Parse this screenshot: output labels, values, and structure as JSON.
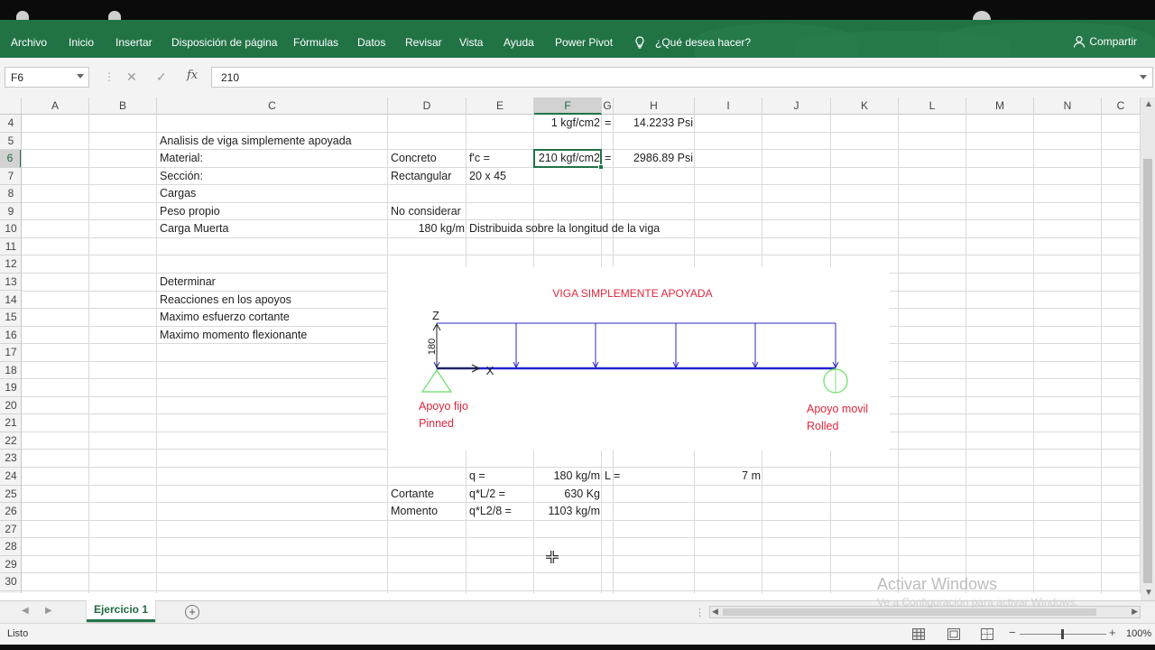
{
  "ribbon": {
    "tabs": [
      "Archivo",
      "Inicio",
      "Insertar",
      "Disposición de página",
      "Fórmulas",
      "Datos",
      "Revisar",
      "Vista",
      "Ayuda",
      "Power Pivot"
    ],
    "tell_me": "¿Qué desea hacer?",
    "share": "Compartir"
  },
  "formula_bar": {
    "name_box": "F6",
    "fx": "fx",
    "value": "210"
  },
  "columns": [
    "A",
    "B",
    "C",
    "D",
    "E",
    "F",
    "G",
    "H",
    "I",
    "J",
    "K",
    "L",
    "M",
    "N",
    "C"
  ],
  "rows": [
    "4",
    "5",
    "6",
    "7",
    "8",
    "9",
    "10",
    "11",
    "12",
    "13",
    "14",
    "15",
    "16",
    "17",
    "18",
    "19",
    "20",
    "21",
    "22",
    "23",
    "24",
    "25",
    "26",
    "27",
    "28",
    "29",
    "30"
  ],
  "cells": {
    "F4": "1 kgf/cm2",
    "G4": "=",
    "H4": "14.2233 Psi",
    "C5": "Analisis de viga simplemente apoyada",
    "C6": "Material:",
    "D6": "Concreto",
    "E6": "f'c =",
    "F6": "210 kgf/cm2",
    "G6": "=",
    "H6": "2986.89 Psi",
    "C7": "Sección:",
    "D7": "Rectangular",
    "E7": "20 x 45",
    "C8": "Cargas",
    "C9": "Peso propio",
    "D9": "No considerar",
    "C10": "Carga Muerta",
    "D10": "180 kg/m",
    "E10": "Distribuida sobre la longitud de la viga",
    "C13": "Determinar",
    "C14": "Reacciones en los apoyos",
    "C15": "Maximo esfuerzo cortante",
    "C16": "Maximo momento flexionante",
    "E24": "q =",
    "F24": "180 kg/m",
    "G24": "L =",
    "I24": "7 m",
    "D25": "Cortante",
    "E25": "q*L/2 =",
    "F25": "630 Kg",
    "D26": "Momento",
    "E26": "q*L2/8 =",
    "F26": "1103 kg/m"
  },
  "diagram": {
    "title": "VIGA SIMPLEMENTE APOYADA",
    "axis_z": "Z",
    "axis_x": "X",
    "load_label": "180",
    "left_support": [
      "Apoyo fijo",
      "Pinned"
    ],
    "right_support": [
      "Apoyo movil",
      "Rolled"
    ],
    "colors": {
      "load": "#2b2bbf",
      "title": "#e0263e",
      "support": "#7be27b",
      "beam": "#2323d0"
    }
  },
  "sheet": {
    "tab": "Ejercicio 1"
  },
  "status": {
    "ready": "Listo",
    "zoom": "100%"
  },
  "watermark": {
    "line1": "Activar Windows",
    "line2": "Ve a Configuración para activar Windows."
  }
}
